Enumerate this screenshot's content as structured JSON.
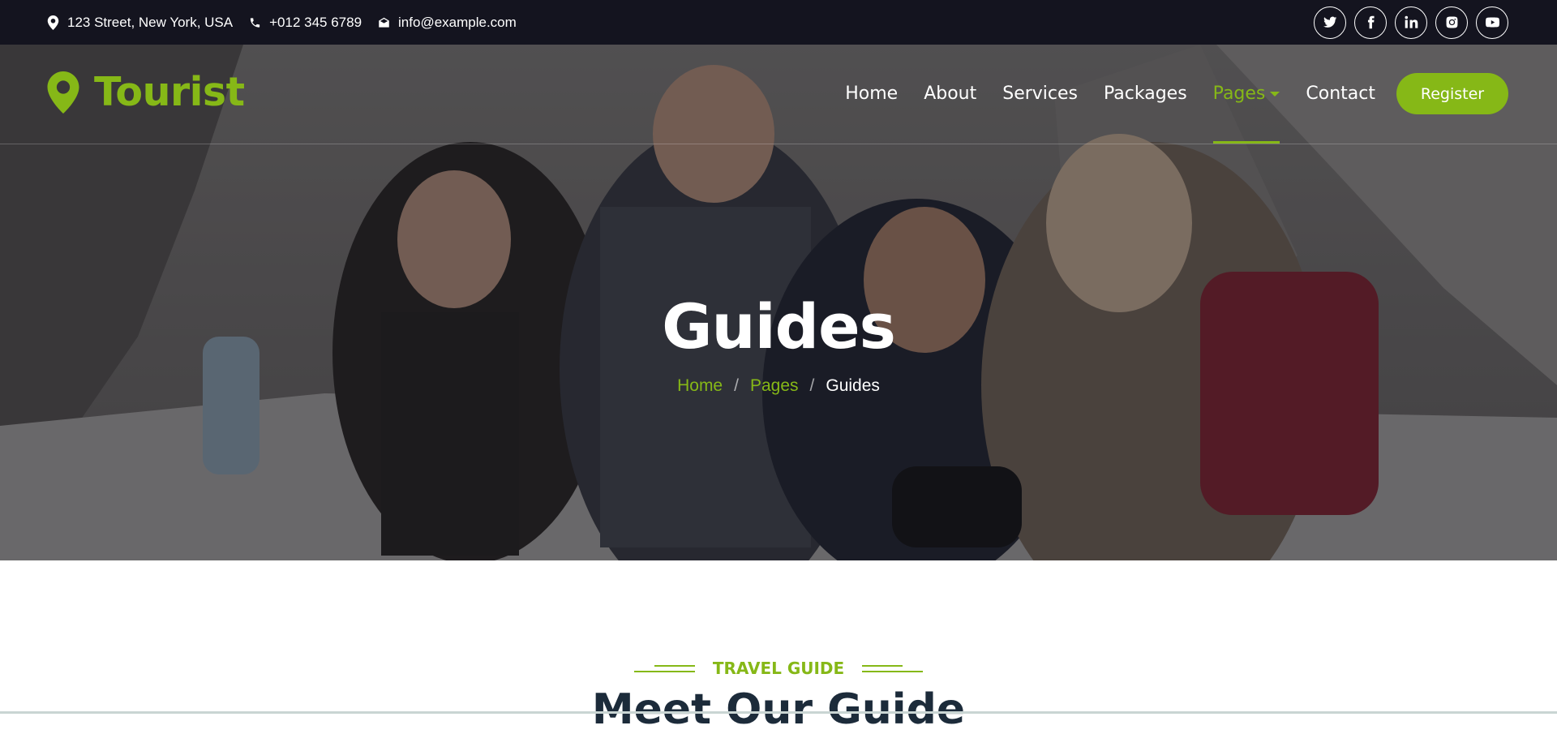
{
  "topbar": {
    "address": "123 Street, New York, USA",
    "phone": "+012 345 6789",
    "email": "info@example.com",
    "social": [
      "twitter-icon",
      "facebook-icon",
      "linkedin-icon",
      "instagram-icon",
      "youtube-icon"
    ]
  },
  "brand": {
    "name": "Tourist",
    "icon": "map-marker-icon",
    "color": "#86b817"
  },
  "nav": {
    "items": [
      {
        "label": "Home"
      },
      {
        "label": "About"
      },
      {
        "label": "Services"
      },
      {
        "label": "Packages"
      },
      {
        "label": "Pages",
        "active": true,
        "dropdown": true
      },
      {
        "label": "Contact"
      }
    ],
    "register_label": "Register"
  },
  "hero": {
    "title": "Guides",
    "breadcrumb": [
      "Home",
      "Pages",
      "Guides"
    ]
  },
  "section": {
    "label": "TRAVEL GUIDE",
    "title": "Meet Our Guide"
  },
  "colors": {
    "accent": "#86b817",
    "dark": "#14141f",
    "heading": "#1c2b3a"
  }
}
